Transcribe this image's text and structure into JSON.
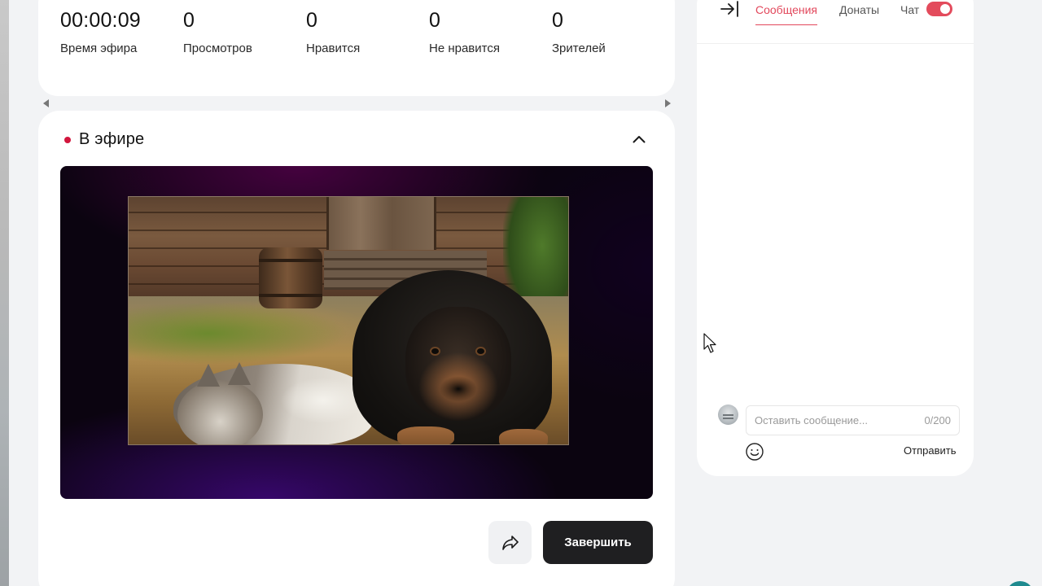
{
  "stats": [
    {
      "value": "00:00:09",
      "label": "Время эфира"
    },
    {
      "value": "0",
      "label": "Просмотров"
    },
    {
      "value": "0",
      "label": "Нравится"
    },
    {
      "value": "0",
      "label": "Не нравится"
    },
    {
      "value": "0",
      "label": "Зрителей"
    }
  ],
  "live": {
    "title": "В эфире",
    "finish_label": "Завершить",
    "status_color": "#d2163d"
  },
  "chat": {
    "tabs": [
      {
        "label": "Сообщения",
        "active": true
      },
      {
        "label": "Донаты",
        "active": false
      }
    ],
    "toggle_label": "Чат",
    "toggle_on": true,
    "input_placeholder": "Оставить сообщение...",
    "input_value": "",
    "counter": "0/200",
    "send_label": "Отправить",
    "accent_color": "#e2485c"
  },
  "icons": {
    "collapse_panel": "arrow-right-to-bar-icon",
    "collapse_section": "chevron-up-icon",
    "share": "share-arrow-icon",
    "emoji": "smiley-icon"
  }
}
